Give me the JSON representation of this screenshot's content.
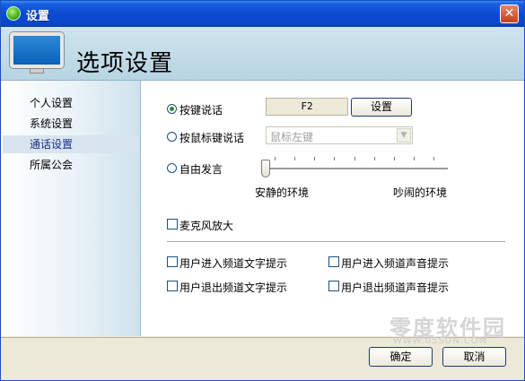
{
  "window": {
    "title": "设置"
  },
  "header": {
    "title": "选项设置"
  },
  "sidebar": {
    "items": [
      {
        "label": "个人设置"
      },
      {
        "label": "系统设置"
      },
      {
        "label": "通话设置"
      },
      {
        "label": "所属公会"
      }
    ],
    "selected": "通话设置"
  },
  "talk": {
    "hotkey_label": "按键说话",
    "hotkey_value": "F2",
    "set_button": "设置",
    "mouse_label": "按鼠标键说话",
    "mouse_select_value": "鼠标左键",
    "free_label": "自由发言",
    "quiet_label": "安静的环境",
    "noisy_label": "吵闹的环境",
    "sensitivity": 0
  },
  "mic": {
    "amplify_label": "麦克风放大"
  },
  "notify": {
    "enter_text": "用户进入频道文字提示",
    "enter_sound": "用户进入频道声音提示",
    "exit_text": "用户退出频道文字提示",
    "exit_sound": "用户退出频道声音提示"
  },
  "footer": {
    "ok": "确定",
    "cancel": "取消"
  },
  "watermark": {
    "text": "零度软件园",
    "url": "WWW.05SUN.COM"
  },
  "colors": {
    "titlebar": "#0a4ad2",
    "header_bg": "#c3dbe7",
    "selected_item_text": "#1a2a8a"
  }
}
